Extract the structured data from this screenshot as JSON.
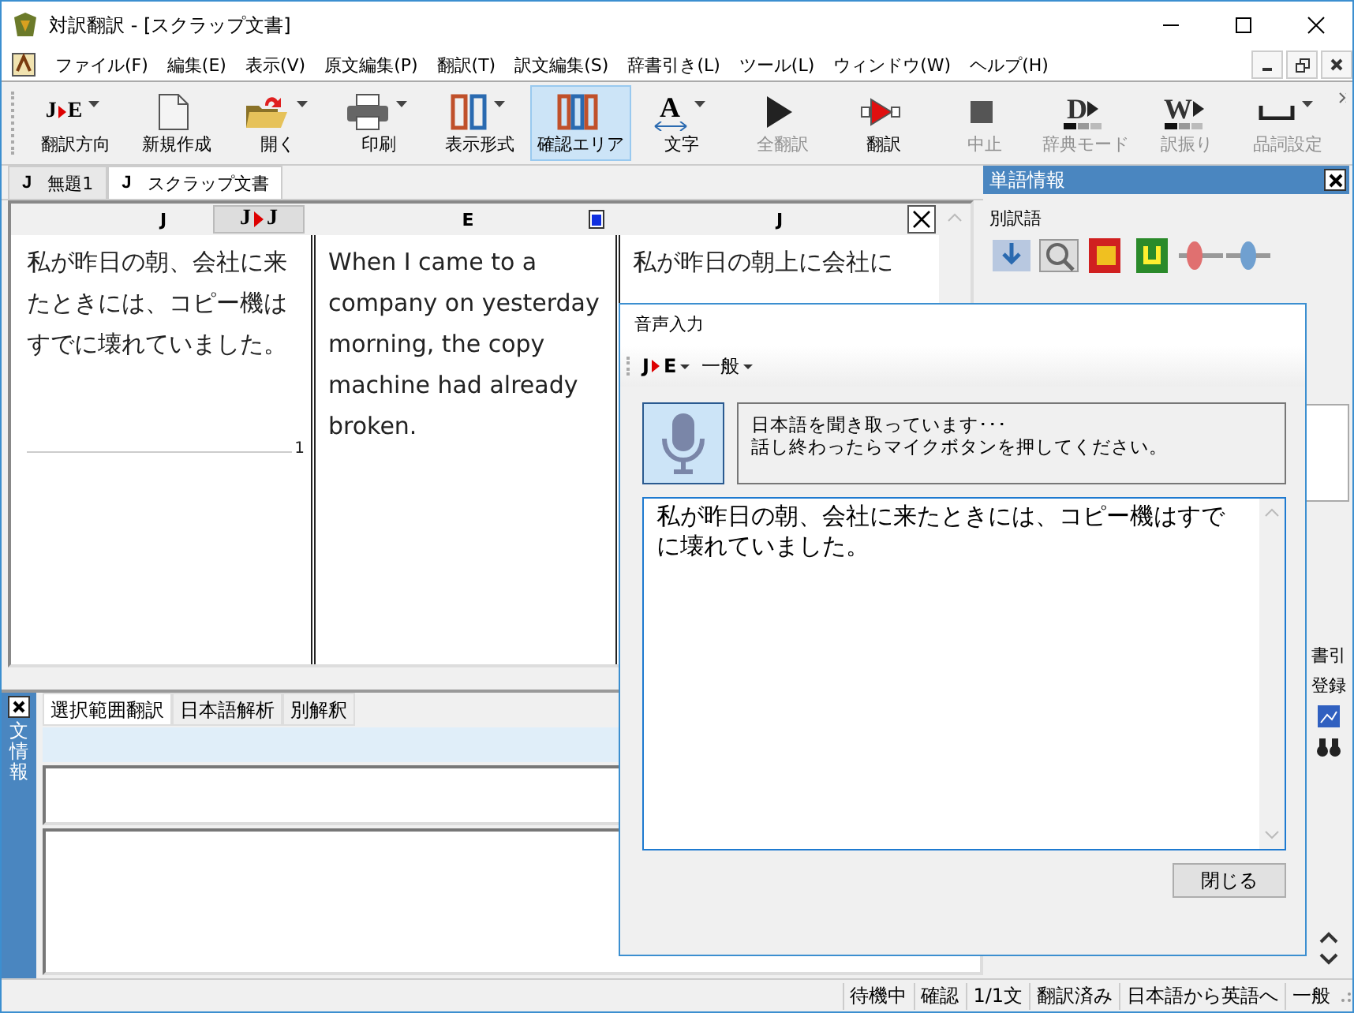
{
  "window": {
    "title": "対訳翻訳 - [スクラップ文書]"
  },
  "menu": [
    "ファイル(F)",
    "編集(E)",
    "表示(V)",
    "原文編集(P)",
    "翻訳(T)",
    "訳文編集(S)",
    "辞書引き(L)",
    "ツール(L)",
    "ウィンドウ(W)",
    "ヘルプ(H)"
  ],
  "toolbar": [
    {
      "kind": "direction",
      "from": "J",
      "to": "E",
      "label": "翻訳方向",
      "dropdown": true,
      "selected": false,
      "disabled": false
    },
    {
      "kind": "newdoc",
      "label": "新規作成",
      "dropdown": false,
      "selected": false,
      "disabled": false
    },
    {
      "kind": "open",
      "label": "開く",
      "dropdown": true,
      "selected": false,
      "disabled": false
    },
    {
      "kind": "print",
      "label": "印刷",
      "dropdown": true,
      "selected": false,
      "disabled": false
    },
    {
      "kind": "layout",
      "label": "表示形式",
      "dropdown": true,
      "selected": false,
      "disabled": false
    },
    {
      "kind": "confirm",
      "label": "確認エリア",
      "dropdown": false,
      "selected": true,
      "disabled": false
    },
    {
      "kind": "font",
      "letter": "A",
      "label": "文字",
      "dropdown": true,
      "selected": false,
      "disabled": false
    },
    {
      "kind": "play",
      "label": "全翻訳",
      "dropdown": false,
      "selected": false,
      "disabled": true
    },
    {
      "kind": "translate",
      "label": "翻訳",
      "dropdown": false,
      "selected": false,
      "disabled": false
    },
    {
      "kind": "stop",
      "label": "中止",
      "dropdown": false,
      "selected": false,
      "disabled": true
    },
    {
      "kind": "letter",
      "letter": "D",
      "label": "辞典モード",
      "dropdown": false,
      "selected": false,
      "disabled": true
    },
    {
      "kind": "letter",
      "letter": "W",
      "label": "訳振り",
      "dropdown": false,
      "selected": false,
      "disabled": true
    },
    {
      "kind": "blank",
      "label": "品詞設定",
      "dropdown": true,
      "selected": false,
      "disabled": true
    }
  ],
  "doc_tabs": [
    {
      "lang": "J",
      "label": "無題1",
      "selected": false
    },
    {
      "lang": "J",
      "label": "スクラップ文書",
      "selected": true
    }
  ],
  "grid": {
    "header": {
      "source": "J",
      "swap": {
        "from": "J",
        "to": "J"
      },
      "target": "E",
      "back": "J"
    },
    "source": "私が昨日の朝、会社に来たときには、コピー機はすでに壊れていました。",
    "target": "When I came to a company on yesterday morning, the copy machine had already broken.",
    "back": "私が昨日の朝上に会社に",
    "line_number": "1"
  },
  "bottom_panel": {
    "side_title": "文情報",
    "tabs": [
      {
        "label": "選択範囲翻訳",
        "selected": true
      },
      {
        "label": "日本語解析",
        "selected": false
      },
      {
        "label": "別解釈",
        "selected": false
      }
    ]
  },
  "word_panel": {
    "title": "単語情報",
    "section": "別訳語",
    "side_texts": [
      "書引",
      "登録"
    ]
  },
  "voice_dialog": {
    "title": "音声入力",
    "direction": {
      "from": "J",
      "to": "E"
    },
    "field": "一般",
    "mic_on": true,
    "message": [
      "日本語を聞き取っています･･･",
      "話し終わったらマイクボタンを押してください。"
    ],
    "text": "私が昨日の朝、会社に来たときには、コピー機はすでに壊れていました。",
    "close": "閉じる"
  },
  "status_bar": [
    "待機中",
    "確認",
    "1/1文",
    "翻訳済み",
    "日本語から英語へ",
    "一般"
  ]
}
